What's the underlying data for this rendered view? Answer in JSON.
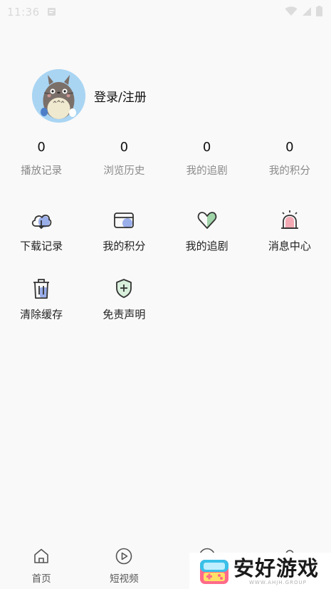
{
  "status_bar": {
    "time": "11:36",
    "icons": [
      "notification-icon",
      "wifi-icon",
      "signal-icon",
      "battery-icon"
    ]
  },
  "profile": {
    "avatar_icon": "totoro-avatar",
    "login_label": "登录/注册"
  },
  "stats": [
    {
      "value": "0",
      "label": "播放记录"
    },
    {
      "value": "0",
      "label": "浏览历史"
    },
    {
      "value": "0",
      "label": "我的追剧"
    },
    {
      "value": "0",
      "label": "我的积分"
    }
  ],
  "features": [
    {
      "label": "下载记录",
      "icon": "cloud-download-icon"
    },
    {
      "label": "我的积分",
      "icon": "card-icon"
    },
    {
      "label": "我的追剧",
      "icon": "heart-icon"
    },
    {
      "label": "消息中心",
      "icon": "alarm-icon"
    },
    {
      "label": "清除缓存",
      "icon": "trash-icon"
    },
    {
      "label": "免责声明",
      "icon": "shield-plus-icon"
    }
  ],
  "bottom_nav": [
    {
      "label": "首页",
      "icon": "home-icon"
    },
    {
      "label": "短视频",
      "icon": "play-icon"
    },
    {
      "label": "",
      "icon": "nav-icon-3"
    },
    {
      "label": "",
      "icon": "nav-icon-4"
    }
  ],
  "watermark": {
    "title": "安好游戏",
    "subtitle": "WWW.AHJH.GROUP"
  },
  "colors": {
    "background": "#f9f9f9",
    "accent_blue": "#8ea4e8",
    "accent_green": "#9fd4a8",
    "accent_pink": "#f3a9b3"
  }
}
